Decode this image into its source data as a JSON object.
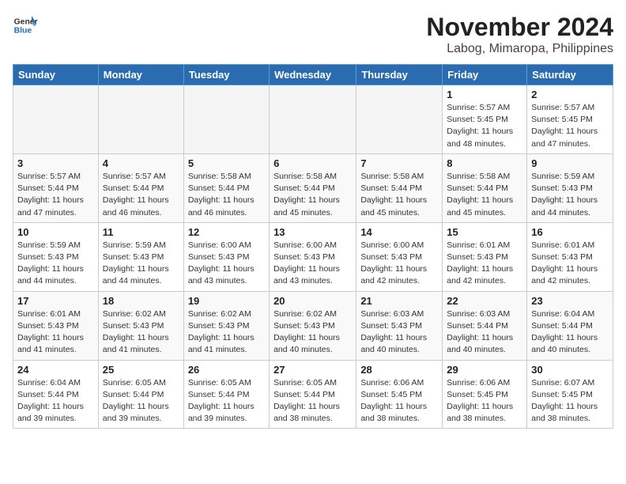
{
  "header": {
    "logo_line1": "General",
    "logo_line2": "Blue",
    "title": "November 2024",
    "subtitle": "Labog, Mimaropa, Philippines"
  },
  "columns": [
    "Sunday",
    "Monday",
    "Tuesday",
    "Wednesday",
    "Thursday",
    "Friday",
    "Saturday"
  ],
  "weeks": [
    [
      {
        "day": "",
        "info": ""
      },
      {
        "day": "",
        "info": ""
      },
      {
        "day": "",
        "info": ""
      },
      {
        "day": "",
        "info": ""
      },
      {
        "day": "",
        "info": ""
      },
      {
        "day": "1",
        "info": "Sunrise: 5:57 AM\nSunset: 5:45 PM\nDaylight: 11 hours\nand 48 minutes."
      },
      {
        "day": "2",
        "info": "Sunrise: 5:57 AM\nSunset: 5:45 PM\nDaylight: 11 hours\nand 47 minutes."
      }
    ],
    [
      {
        "day": "3",
        "info": "Sunrise: 5:57 AM\nSunset: 5:44 PM\nDaylight: 11 hours\nand 47 minutes."
      },
      {
        "day": "4",
        "info": "Sunrise: 5:57 AM\nSunset: 5:44 PM\nDaylight: 11 hours\nand 46 minutes."
      },
      {
        "day": "5",
        "info": "Sunrise: 5:58 AM\nSunset: 5:44 PM\nDaylight: 11 hours\nand 46 minutes."
      },
      {
        "day": "6",
        "info": "Sunrise: 5:58 AM\nSunset: 5:44 PM\nDaylight: 11 hours\nand 45 minutes."
      },
      {
        "day": "7",
        "info": "Sunrise: 5:58 AM\nSunset: 5:44 PM\nDaylight: 11 hours\nand 45 minutes."
      },
      {
        "day": "8",
        "info": "Sunrise: 5:58 AM\nSunset: 5:44 PM\nDaylight: 11 hours\nand 45 minutes."
      },
      {
        "day": "9",
        "info": "Sunrise: 5:59 AM\nSunset: 5:43 PM\nDaylight: 11 hours\nand 44 minutes."
      }
    ],
    [
      {
        "day": "10",
        "info": "Sunrise: 5:59 AM\nSunset: 5:43 PM\nDaylight: 11 hours\nand 44 minutes."
      },
      {
        "day": "11",
        "info": "Sunrise: 5:59 AM\nSunset: 5:43 PM\nDaylight: 11 hours\nand 44 minutes."
      },
      {
        "day": "12",
        "info": "Sunrise: 6:00 AM\nSunset: 5:43 PM\nDaylight: 11 hours\nand 43 minutes."
      },
      {
        "day": "13",
        "info": "Sunrise: 6:00 AM\nSunset: 5:43 PM\nDaylight: 11 hours\nand 43 minutes."
      },
      {
        "day": "14",
        "info": "Sunrise: 6:00 AM\nSunset: 5:43 PM\nDaylight: 11 hours\nand 42 minutes."
      },
      {
        "day": "15",
        "info": "Sunrise: 6:01 AM\nSunset: 5:43 PM\nDaylight: 11 hours\nand 42 minutes."
      },
      {
        "day": "16",
        "info": "Sunrise: 6:01 AM\nSunset: 5:43 PM\nDaylight: 11 hours\nand 42 minutes."
      }
    ],
    [
      {
        "day": "17",
        "info": "Sunrise: 6:01 AM\nSunset: 5:43 PM\nDaylight: 11 hours\nand 41 minutes."
      },
      {
        "day": "18",
        "info": "Sunrise: 6:02 AM\nSunset: 5:43 PM\nDaylight: 11 hours\nand 41 minutes."
      },
      {
        "day": "19",
        "info": "Sunrise: 6:02 AM\nSunset: 5:43 PM\nDaylight: 11 hours\nand 41 minutes."
      },
      {
        "day": "20",
        "info": "Sunrise: 6:02 AM\nSunset: 5:43 PM\nDaylight: 11 hours\nand 40 minutes."
      },
      {
        "day": "21",
        "info": "Sunrise: 6:03 AM\nSunset: 5:43 PM\nDaylight: 11 hours\nand 40 minutes."
      },
      {
        "day": "22",
        "info": "Sunrise: 6:03 AM\nSunset: 5:44 PM\nDaylight: 11 hours\nand 40 minutes."
      },
      {
        "day": "23",
        "info": "Sunrise: 6:04 AM\nSunset: 5:44 PM\nDaylight: 11 hours\nand 40 minutes."
      }
    ],
    [
      {
        "day": "24",
        "info": "Sunrise: 6:04 AM\nSunset: 5:44 PM\nDaylight: 11 hours\nand 39 minutes."
      },
      {
        "day": "25",
        "info": "Sunrise: 6:05 AM\nSunset: 5:44 PM\nDaylight: 11 hours\nand 39 minutes."
      },
      {
        "day": "26",
        "info": "Sunrise: 6:05 AM\nSunset: 5:44 PM\nDaylight: 11 hours\nand 39 minutes."
      },
      {
        "day": "27",
        "info": "Sunrise: 6:05 AM\nSunset: 5:44 PM\nDaylight: 11 hours\nand 38 minutes."
      },
      {
        "day": "28",
        "info": "Sunrise: 6:06 AM\nSunset: 5:45 PM\nDaylight: 11 hours\nand 38 minutes."
      },
      {
        "day": "29",
        "info": "Sunrise: 6:06 AM\nSunset: 5:45 PM\nDaylight: 11 hours\nand 38 minutes."
      },
      {
        "day": "30",
        "info": "Sunrise: 6:07 AM\nSunset: 5:45 PM\nDaylight: 11 hours\nand 38 minutes."
      }
    ]
  ],
  "colors": {
    "header_bg": "#2b6cb0",
    "header_text": "#ffffff",
    "alt_row_bg": "#f0f0f0",
    "normal_row_bg": "#ffffff"
  }
}
